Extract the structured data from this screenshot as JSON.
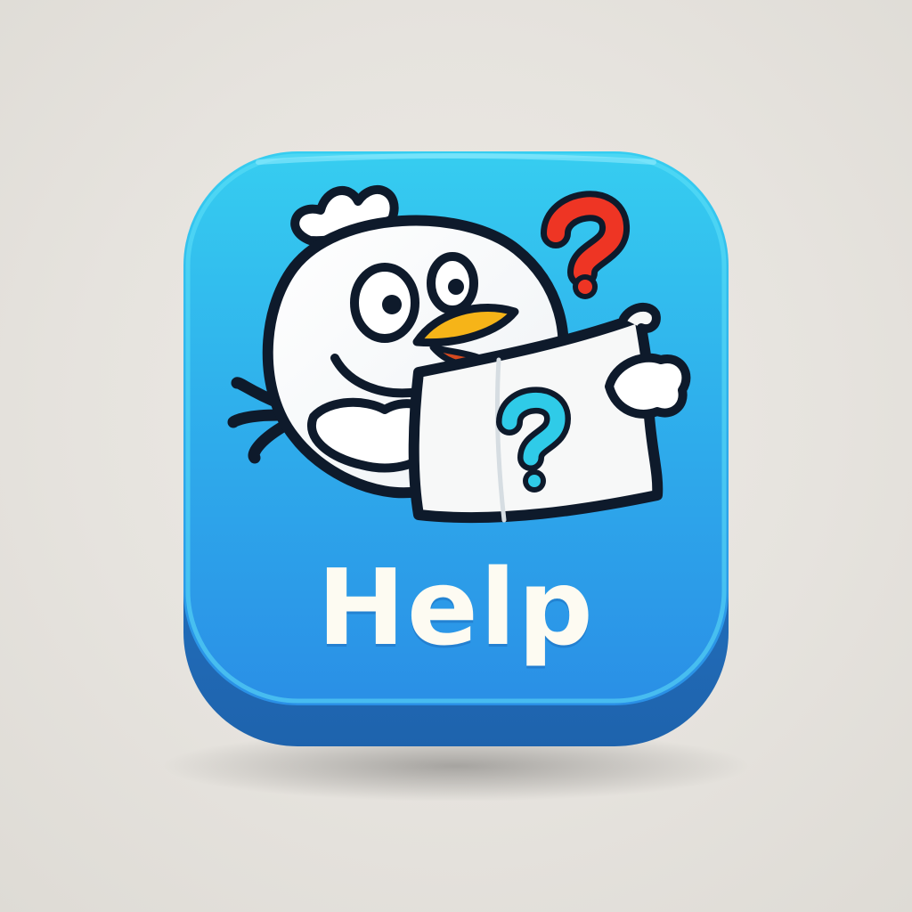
{
  "app_icon": {
    "label": "Help",
    "illustration": "bird-reading-help-paper",
    "icons": [
      "bird-icon",
      "question-mark-icon",
      "question-mark-icon"
    ],
    "colors": {
      "tile_top": "#33c9ef",
      "tile_bottom": "#2a8fe6",
      "tile_side": "#2478c9",
      "label_text": "#fdfbf2",
      "outline": "#0e1a2b",
      "question_red": "#ee3524",
      "question_cyan": "#2fcbe8",
      "beak": "#f6b418"
    }
  }
}
